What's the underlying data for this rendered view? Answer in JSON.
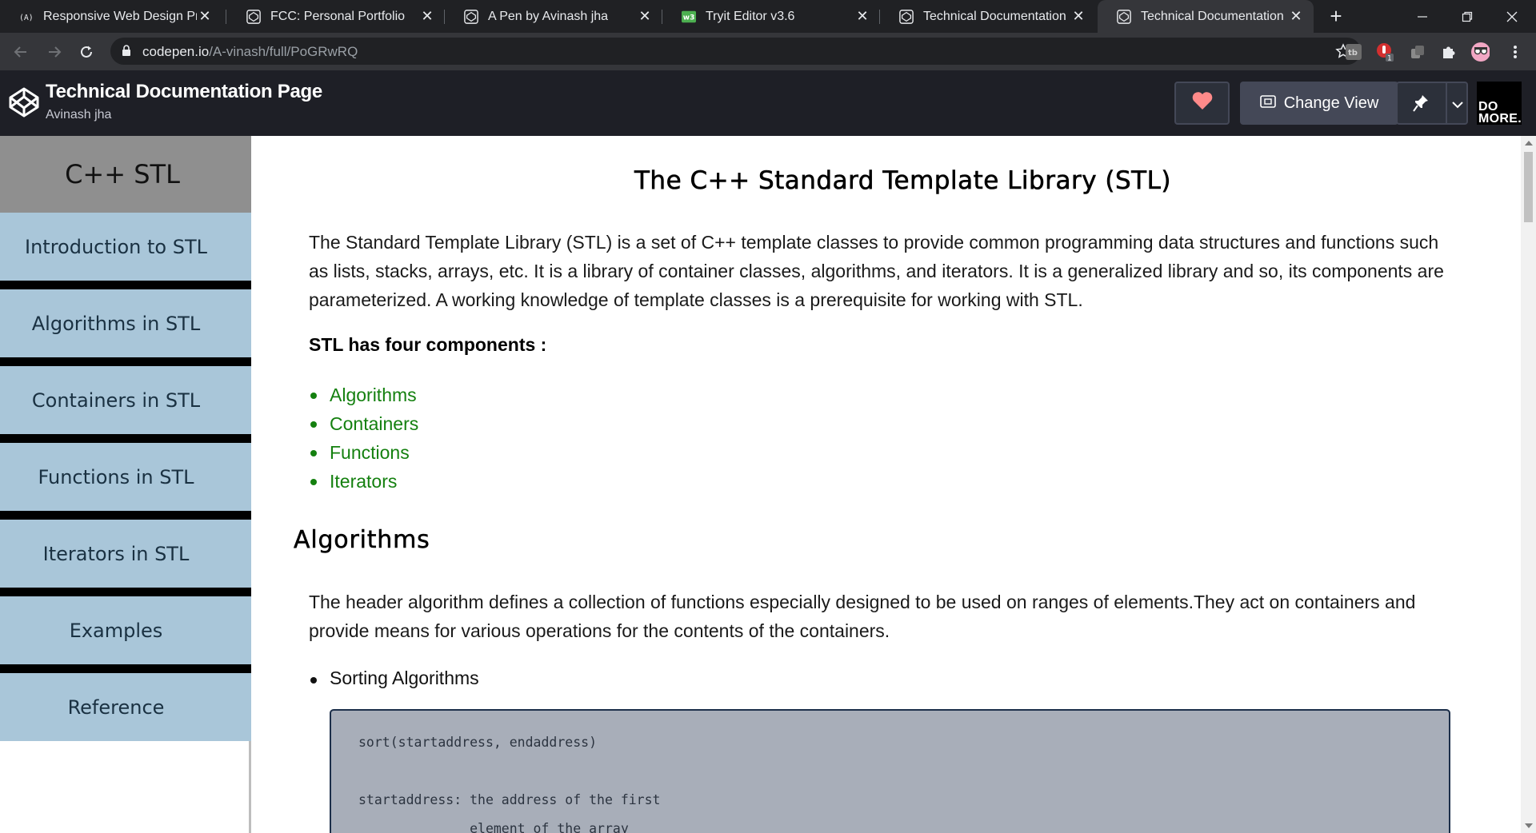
{
  "browser": {
    "tabs": [
      {
        "title": "Responsive Web Design Proje",
        "icon": "fcc-icon"
      },
      {
        "title": "FCC: Personal Portfolio",
        "icon": "codepen-icon"
      },
      {
        "title": "A Pen by Avinash jha",
        "icon": "codepen-icon"
      },
      {
        "title": "Tryit Editor v3.6",
        "icon": "w3schools-icon"
      },
      {
        "title": "Technical Documentation Pa",
        "icon": "codepen-icon"
      },
      {
        "title": "Technical Documentation Pa",
        "icon": "codepen-icon",
        "active": true
      }
    ],
    "url_host": "codepen.io",
    "url_path": "/A-vinash/full/PoGRwRQ",
    "extension_badge": "1"
  },
  "codepen": {
    "title": "Technical Documentation Page",
    "author": "Avinash jha",
    "change_view_label": "Change View",
    "do_more_line1": "DO",
    "do_more_line2": "MORE."
  },
  "nav": {
    "header": "C++ STL",
    "links": [
      "Introduction to STL",
      "Algorithms in STL",
      "Containers in STL",
      "Functions in STL",
      "Iterators in STL",
      "Examples",
      "Reference"
    ]
  },
  "main": {
    "title": "The C++ Standard Template Library (STL)",
    "intro": "The Standard Template Library (STL) is a set of C++ template classes to provide common programming data structures and functions such as lists, stacks, arrays, etc. It is a library of container classes, algorithms, and iterators. It is a generalized library and so, its components are parameterized. A working knowledge of template classes is a prerequisite for working with STL.",
    "components_heading": "STL has four components :",
    "components": [
      "Algorithms",
      "Containers",
      "Functions",
      "Iterators"
    ],
    "algorithms_heading": "Algorithms",
    "algorithms_text": "The header algorithm defines a collection of functions especially designed to be used on ranges of elements.They act on containers and provide means for various operations for the contents of the containers.",
    "sorting_item": "Sorting Algorithms",
    "code": "sort(startaddress, endaddress)\n\nstartaddress: the address of the first\n              element of the array"
  },
  "colors": {
    "nav_header_bg": "#8f8f8f",
    "nav_link_bg": "#a9c6d9",
    "link_green": "#14800f",
    "code_bg": "#a8aeb9",
    "codepen_header_bg": "#1e1f26"
  }
}
